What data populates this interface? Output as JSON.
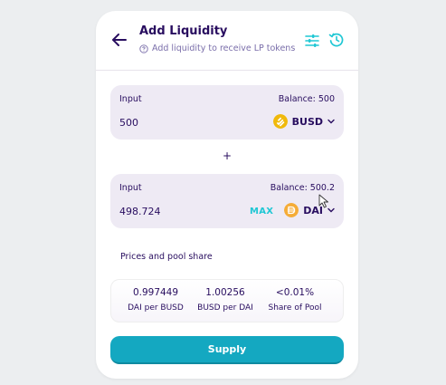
{
  "header": {
    "title": "Add Liquidity",
    "subtitle": "Add liquidity to receive LP tokens",
    "icons": {
      "back": "arrow-left-icon",
      "help": "question-circle-icon",
      "settings": "sliders-icon",
      "history": "history-icon"
    }
  },
  "input_a": {
    "label": "Input",
    "balance": "Balance: 500",
    "amount": "500",
    "token": "BUSD",
    "token_color": "#f0b90b"
  },
  "plus_sign": "+",
  "input_b": {
    "label": "Input",
    "balance": "Balance: 500.2",
    "amount": "498.724",
    "max_label": "MAX",
    "token": "DAI",
    "token_color": "#f5ac37"
  },
  "prices": {
    "title": "Prices and pool share",
    "items": [
      {
        "value": "0.997449",
        "label": "DAI per BUSD"
      },
      {
        "value": "1.00256",
        "label": "BUSD per DAI"
      },
      {
        "value": "<0.01%",
        "label": "Share of Pool"
      }
    ]
  },
  "supply_label": "Supply",
  "colors": {
    "accent": "#1fc7d4",
    "primary_button": "#14a8c1",
    "text": "#280d5f",
    "panel": "#eeeaf4"
  }
}
